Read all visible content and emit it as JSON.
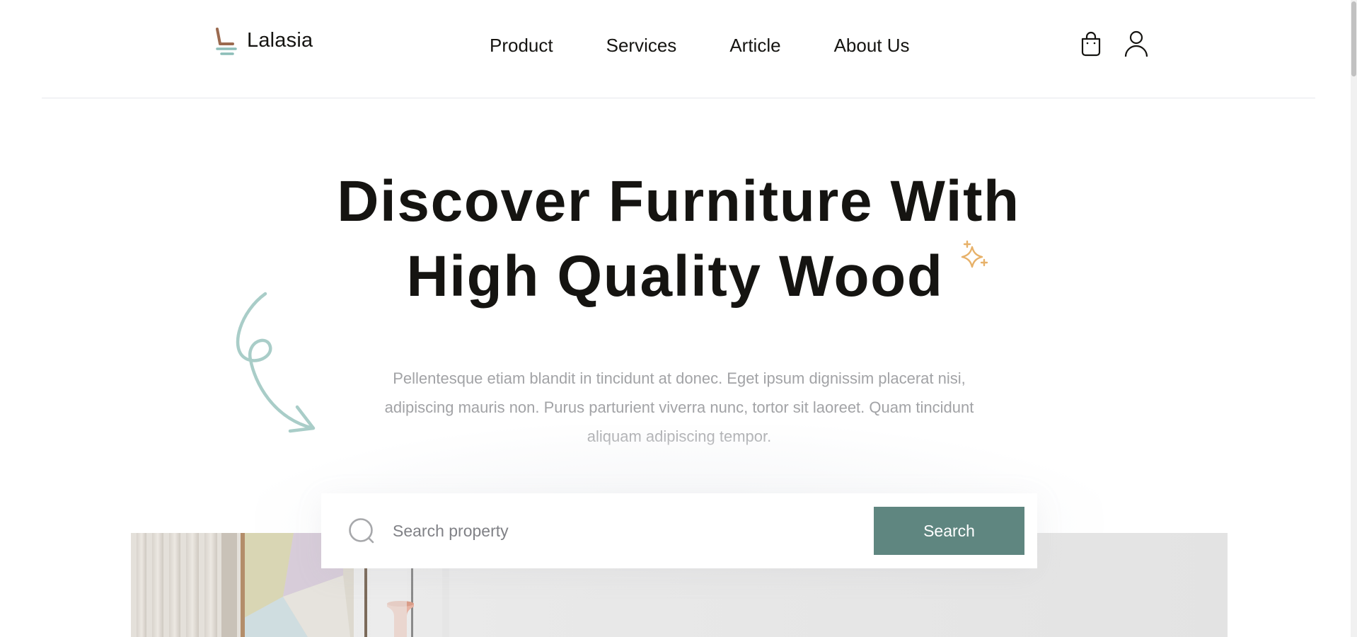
{
  "brand": {
    "name": "Lalasia",
    "logo_icon": "chair-icon",
    "colors": {
      "seat": "#9b6a4f",
      "base": "#8cbdb8"
    }
  },
  "nav": {
    "items": [
      {
        "label": "Product"
      },
      {
        "label": "Services"
      },
      {
        "label": "Article"
      },
      {
        "label": "About Us"
      }
    ]
  },
  "header_icons": {
    "cart": "shopping-bag-icon",
    "profile": "user-icon"
  },
  "hero": {
    "title_line1": "Discover Furniture With",
    "title_line2": "High Quality Wood",
    "description": "Pellentesque etiam blandit in tincidunt at donec. Eget ipsum dignissim placerat nisi, adipiscing mauris non. Purus parturient viverra nunc, tortor sit laoreet. Quam tincidunt aliquam adipiscing tempor.",
    "decorations": {
      "sparkle": "sparkle-icon",
      "arrow": "curly-arrow-icon"
    }
  },
  "search": {
    "placeholder": "Search property",
    "value": "",
    "button_label": "Search",
    "icon": "search-icon"
  },
  "colors": {
    "primary": "#5f8680",
    "text": "#151411",
    "muted_text": "#a2a3a6",
    "accent_sparkle": "#e7b169",
    "accent_arrow": "#a9cdc8",
    "divider": "#e6e8ec"
  }
}
